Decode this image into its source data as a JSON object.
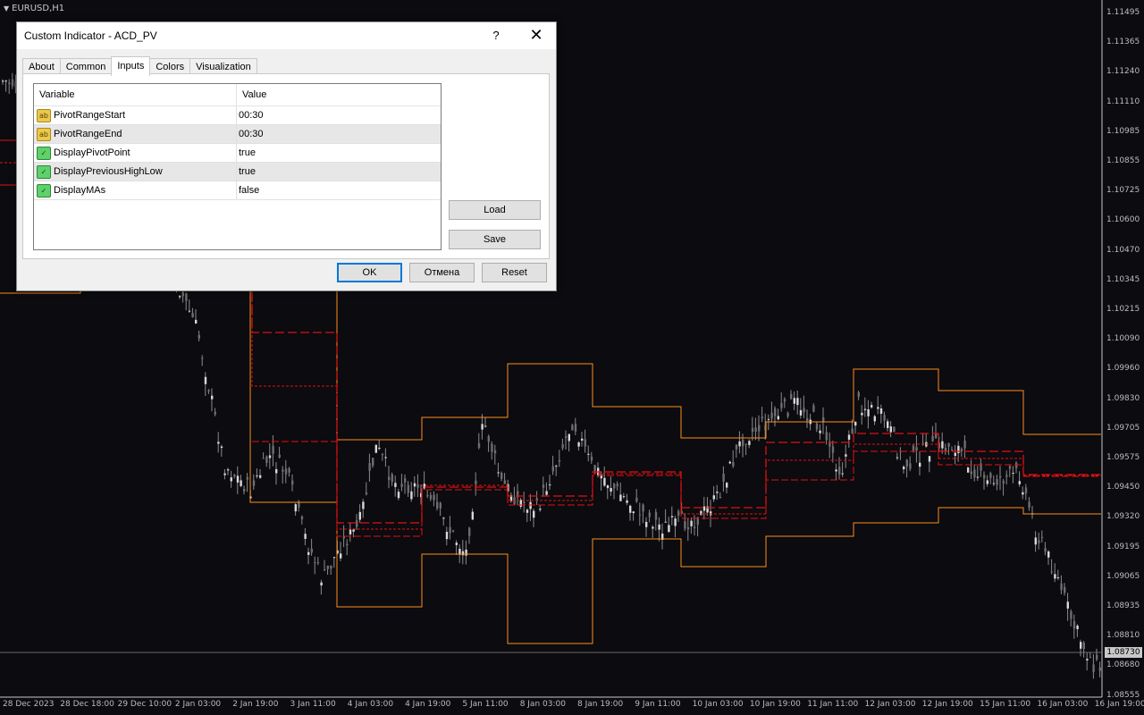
{
  "chart": {
    "symbol": "EURUSD,H1",
    "current_price": "1.08730",
    "price_labels": [
      "1.11495",
      "1.11365",
      "1.11240",
      "1.11110",
      "1.10985",
      "1.10855",
      "1.10725",
      "1.10600",
      "1.10470",
      "1.10345",
      "1.10215",
      "1.10090",
      "1.09960",
      "1.09830",
      "1.09705",
      "1.09575",
      "1.09450",
      "1.09320",
      "1.09195",
      "1.09065",
      "1.08935",
      "1.08810",
      "1.08680",
      "1.08555"
    ],
    "time_labels": [
      "28 Dec 2023",
      "28 Dec 18:00",
      "29 Dec 10:00",
      "2 Jan 03:00",
      "2 Jan 19:00",
      "3 Jan 11:00",
      "4 Jan 03:00",
      "4 Jan 19:00",
      "5 Jan 11:00",
      "8 Jan 03:00",
      "8 Jan 19:00",
      "9 Jan 11:00",
      "10 Jan 03:00",
      "10 Jan 19:00",
      "11 Jan 11:00",
      "12 Jan 03:00",
      "12 Jan 19:00",
      "15 Jan 11:00",
      "16 Jan 03:00",
      "16 Jan 19:00"
    ],
    "colors": {
      "background": "#0b0b10",
      "candles": "#8c8c8c",
      "range_lines": "#ff8c1a",
      "pivot_lines": "#e01010"
    }
  },
  "dialog": {
    "title": "Custom Indicator - ACD_PV",
    "help_glyph": "?",
    "close_glyph": "✕",
    "tabs": [
      {
        "label": "About",
        "active": false
      },
      {
        "label": "Common",
        "active": false
      },
      {
        "label": "Inputs",
        "active": true
      },
      {
        "label": "Colors",
        "active": false
      },
      {
        "label": "Visualization",
        "active": false
      }
    ],
    "grid": {
      "headers": {
        "variable": "Variable",
        "value": "Value"
      },
      "rows": [
        {
          "icon": "ab",
          "icon_name": "string-type-icon",
          "variable": "PivotRangeStart",
          "value": "00:30"
        },
        {
          "icon": "bool",
          "icon_name": "boolean-type-icon",
          "variable": "PivotRangeEnd",
          "value": "00:30",
          "icon_text": "ab"
        },
        {
          "icon": "bool",
          "icon_name": "boolean-type-icon",
          "variable": "DisplayPivotPoint",
          "value": "true"
        },
        {
          "icon": "bool",
          "icon_name": "boolean-type-icon",
          "variable": "DisplayPreviousHighLow",
          "value": "true"
        },
        {
          "icon": "bool",
          "icon_name": "boolean-type-icon",
          "variable": "DisplayMAs",
          "value": "false"
        }
      ]
    },
    "buttons": {
      "load": "Load",
      "save": "Save",
      "ok": "OK",
      "cancel": "Отмена",
      "reset": "Reset"
    }
  }
}
